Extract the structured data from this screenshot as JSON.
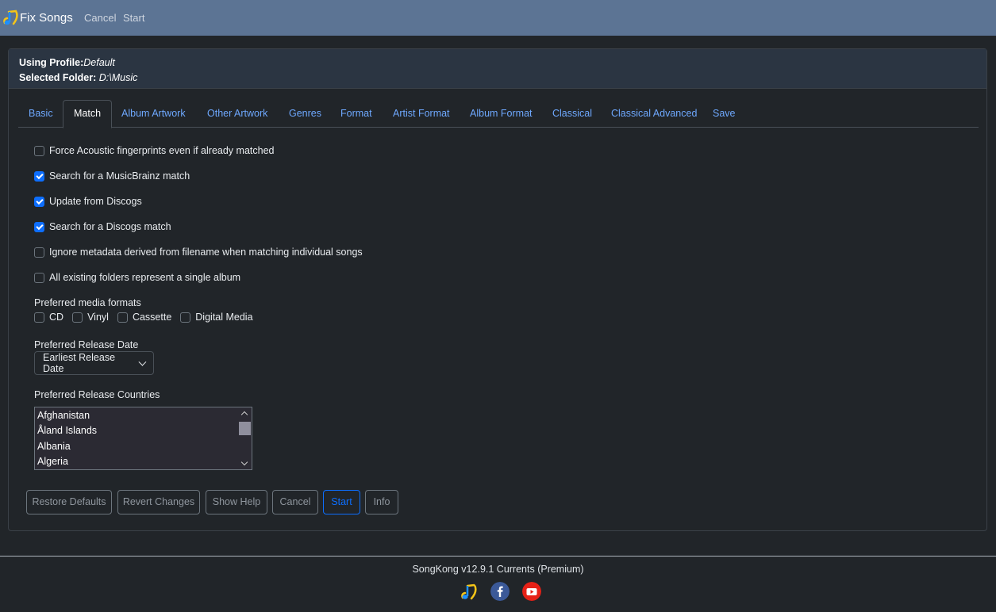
{
  "app": {
    "title": "Fix Songs",
    "menu": [
      "Cancel",
      "Start"
    ]
  },
  "header": {
    "profile_label": "Using Profile:",
    "profile_value": "Default",
    "folder_label": "Selected Folder:",
    "folder_value": "D:\\Music"
  },
  "tabs": [
    {
      "label": "Basic",
      "active": false
    },
    {
      "label": "Match",
      "active": true
    },
    {
      "label": "Album Artwork",
      "active": false
    },
    {
      "label": "Other Artwork",
      "active": false
    },
    {
      "label": "Genres",
      "active": false
    },
    {
      "label": "Format",
      "active": false
    },
    {
      "label": "Artist Format",
      "active": false
    },
    {
      "label": "Album Format",
      "active": false
    },
    {
      "label": "Classical",
      "active": false
    },
    {
      "label": "Classical Advanced",
      "active": false
    },
    {
      "label": "Save",
      "active": false
    }
  ],
  "options": [
    {
      "label": "Force Acoustic fingerprints even if already matched",
      "checked": false
    },
    {
      "label": "Search for a MusicBrainz match",
      "checked": true
    },
    {
      "label": "Update from Discogs",
      "checked": true
    },
    {
      "label": "Search for a Discogs match",
      "checked": true
    },
    {
      "label": "Ignore metadata derived from filename when matching individual songs",
      "checked": false
    },
    {
      "label": "All existing folders represent a single album",
      "checked": false
    }
  ],
  "media_formats": {
    "label": "Preferred media formats",
    "items": [
      {
        "label": "CD",
        "checked": false
      },
      {
        "label": "Vinyl",
        "checked": false
      },
      {
        "label": "Cassette",
        "checked": false
      },
      {
        "label": "Digital Media",
        "checked": false
      }
    ]
  },
  "release_date": {
    "label": "Preferred Release Date",
    "value": "Earliest Release Date"
  },
  "countries": {
    "label": "Preferred Release Countries",
    "items": [
      "Afghanistan",
      "Åland Islands",
      "Albania",
      "Algeria"
    ]
  },
  "buttons": [
    {
      "label": "Restore Defaults",
      "primary": false
    },
    {
      "label": "Revert Changes",
      "primary": false
    },
    {
      "label": "Show Help",
      "primary": false
    },
    {
      "label": "Cancel",
      "primary": false
    },
    {
      "label": "Start",
      "primary": true
    },
    {
      "label": "Info",
      "primary": false
    }
  ],
  "footer": {
    "version": "SongKong v12.9.1 Currents (Premium)"
  },
  "colors": {
    "topbar": "#5c7494",
    "accent": "#0d6efd",
    "link": "#6ea8fe",
    "background": "#212529"
  }
}
